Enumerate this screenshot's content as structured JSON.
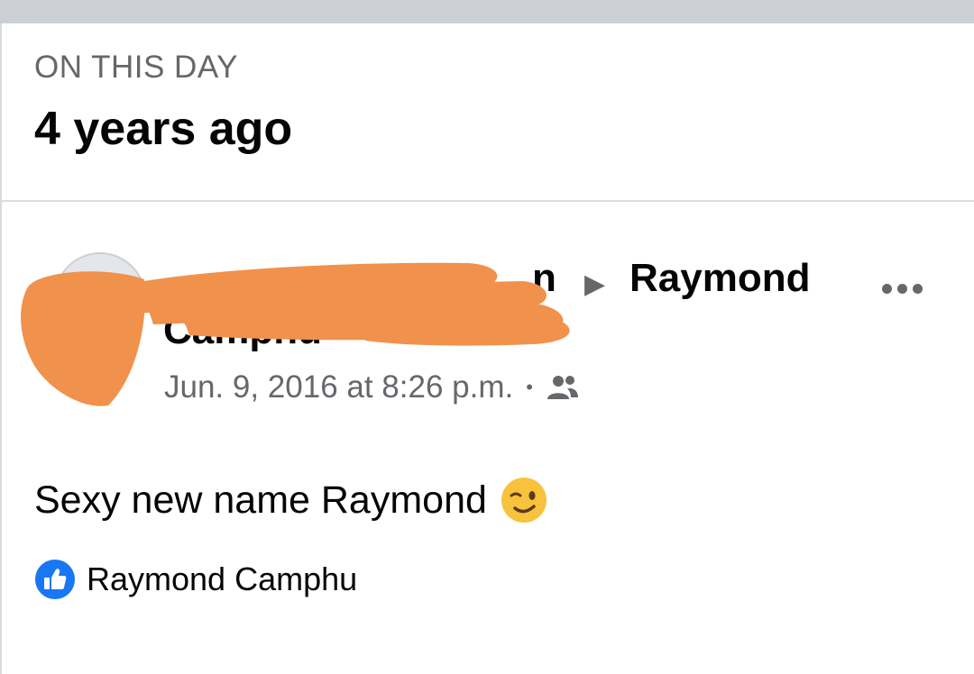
{
  "section": {
    "label": "ON THIS DAY",
    "title": "4 years ago"
  },
  "post": {
    "author_suffix": "n",
    "arrow": "▶",
    "recipient_first": "Raymond",
    "recipient_last": "Camphu",
    "timestamp": "Jun. 9, 2016 at 8:26 p.m.",
    "separator": "•",
    "audience_icon": "friends-icon",
    "text": "Sexy new name Raymond",
    "emoji": "winking-face-emoji"
  },
  "reactions": {
    "icon": "like-icon",
    "names": "Raymond Camphu"
  },
  "colors": {
    "top_bar": "#ccd0d5",
    "redaction": "#f0914c",
    "like_blue": "#1877f2",
    "secondary_text": "#65676b"
  }
}
